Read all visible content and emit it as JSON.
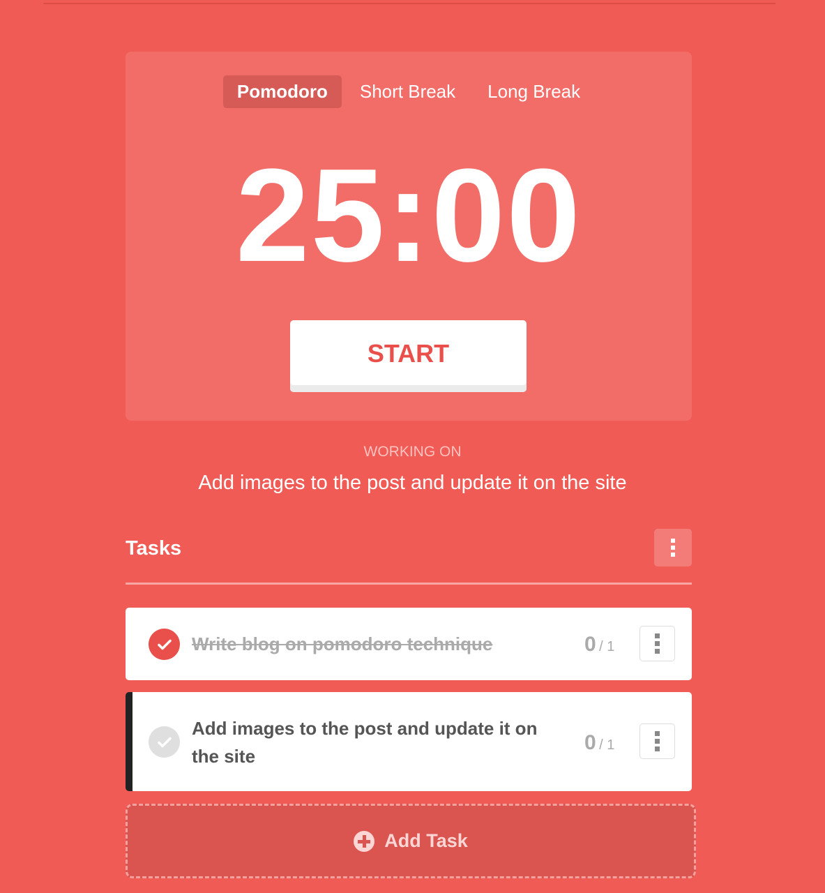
{
  "modes": [
    {
      "label": "Pomodoro",
      "active": true
    },
    {
      "label": "Short Break",
      "active": false
    },
    {
      "label": "Long Break",
      "active": false
    }
  ],
  "timer": {
    "display": "25:00"
  },
  "start_button": {
    "label": "START"
  },
  "working_on": {
    "label": "WORKING ON",
    "task": "Add images to the post and update it on the site"
  },
  "tasks_section": {
    "title": "Tasks"
  },
  "tasks": [
    {
      "title": "Write blog on pomodoro technique",
      "completed": true,
      "done": "0",
      "sep_total": "/ 1"
    },
    {
      "title": "Add images to the post and update it on the site",
      "completed": false,
      "selected": true,
      "done": "0",
      "sep_total": "/ 1"
    }
  ],
  "add_task": {
    "label": "Add Task"
  },
  "colors": {
    "background": "#f05b56",
    "card": "#f26c68",
    "accent": "#e9504b"
  }
}
